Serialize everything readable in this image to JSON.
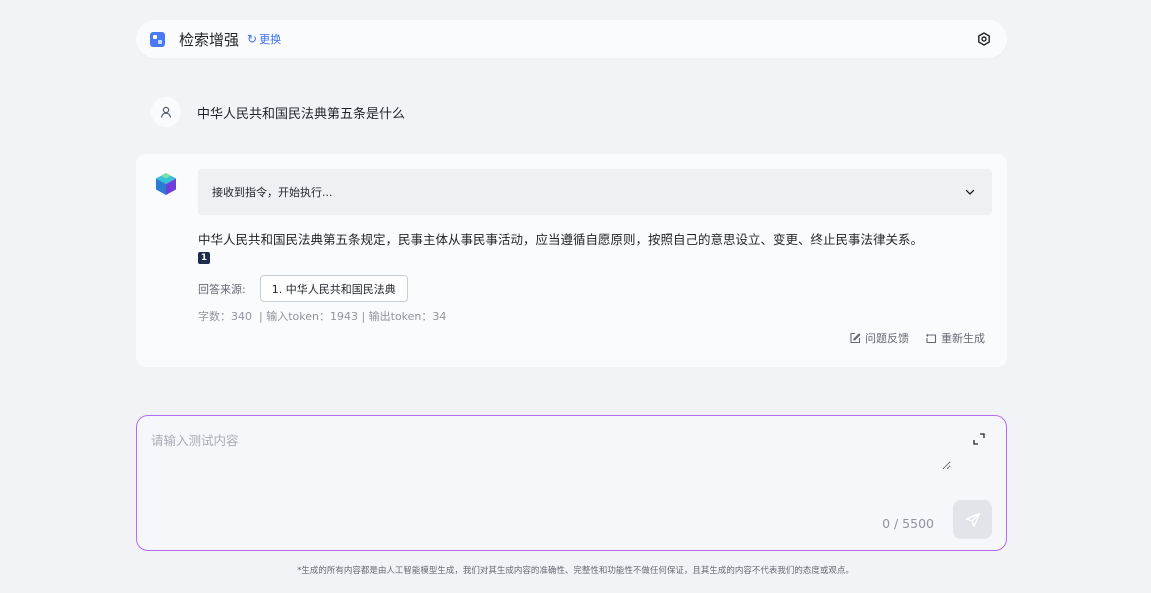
{
  "header": {
    "title": "检索增强",
    "switch_label": "更换",
    "icons": [
      "app-icon",
      "refresh-icon",
      "settings-icon"
    ]
  },
  "conversation": {
    "user_question": "中华人民共和国民法典第五条是什么",
    "status_text": "接收到指令，开始执行...",
    "answer_text": "中华人民共和国民法典第五条规定，民事主体从事民事活动，应当遵循自愿原则，按照自己的意思设立、变更、终止民事法律关系。",
    "citation_marker": "1",
    "source_label": "回答来源:",
    "source_chip": "1. 中华人民共和国民法典",
    "stats": "字数：340  | 输入token：1943 | 输出token：34",
    "actions": {
      "feedback": "问题反馈",
      "regenerate": "重新生成"
    }
  },
  "input": {
    "placeholder": "请输入测试内容",
    "counter": "0 / 5500"
  },
  "disclaimer": "*生成的所有内容都是由人工智能模型生成，我们对其生成内容的准确性、完整性和功能性不做任何保证，且其生成的内容不代表我们的态度或观点。",
  "colors": {
    "background": "#f2f3f6",
    "accent": "#3f6ef5",
    "input_border": "#b36cf2",
    "citation_bg": "#1d2b4d"
  }
}
